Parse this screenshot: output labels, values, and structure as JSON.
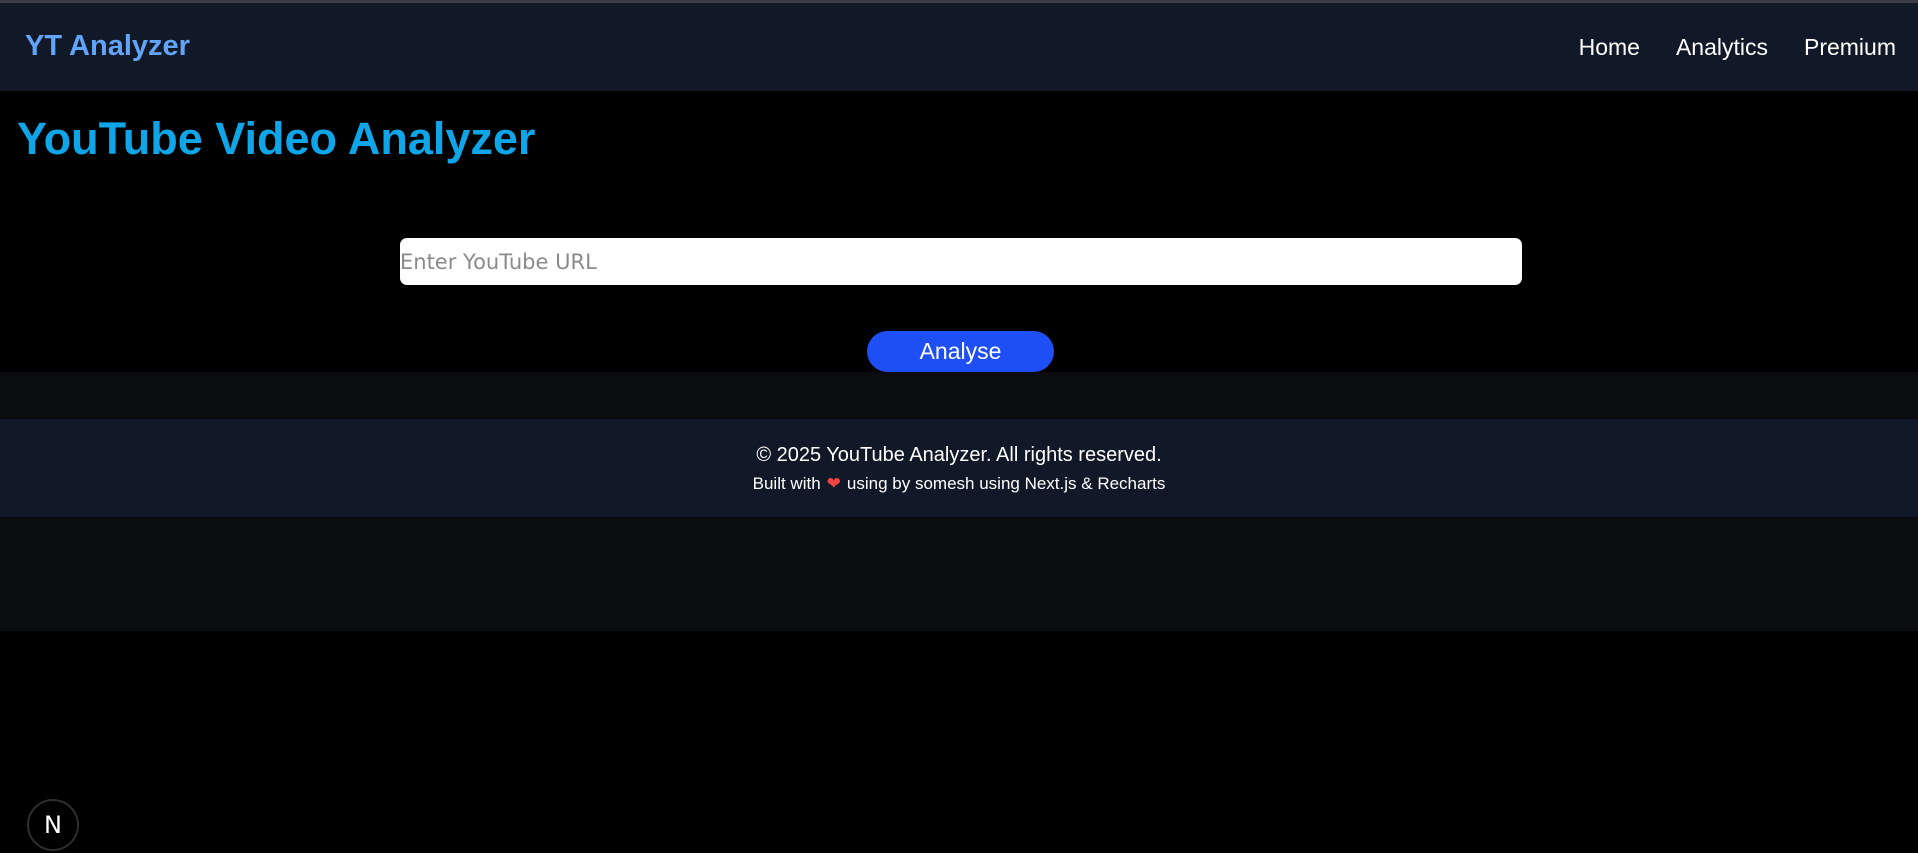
{
  "navbar": {
    "brand": "YT Analyzer",
    "links": [
      "Home",
      "Analytics",
      "Premium"
    ]
  },
  "main": {
    "title": "YouTube Video Analyzer",
    "url_input": {
      "value": "",
      "placeholder": "Enter YouTube URL"
    },
    "analyse_label": "Analyse"
  },
  "footer": {
    "copyright": "© 2025 YouTube Analyzer. All rights reserved.",
    "built_prefix": "Built with",
    "built_suffix": "using by somesh using Next.js & Recharts",
    "heart_icon": "heart-icon"
  },
  "dev_badge": {
    "label": "N",
    "icon": "nextjs-logo-icon"
  },
  "colors": {
    "background": "#000000",
    "navbar": "#111827",
    "brand": "#60a5fa",
    "title": "#0ea5e9",
    "button": "#1d4ff5",
    "heart": "#ef4444"
  }
}
